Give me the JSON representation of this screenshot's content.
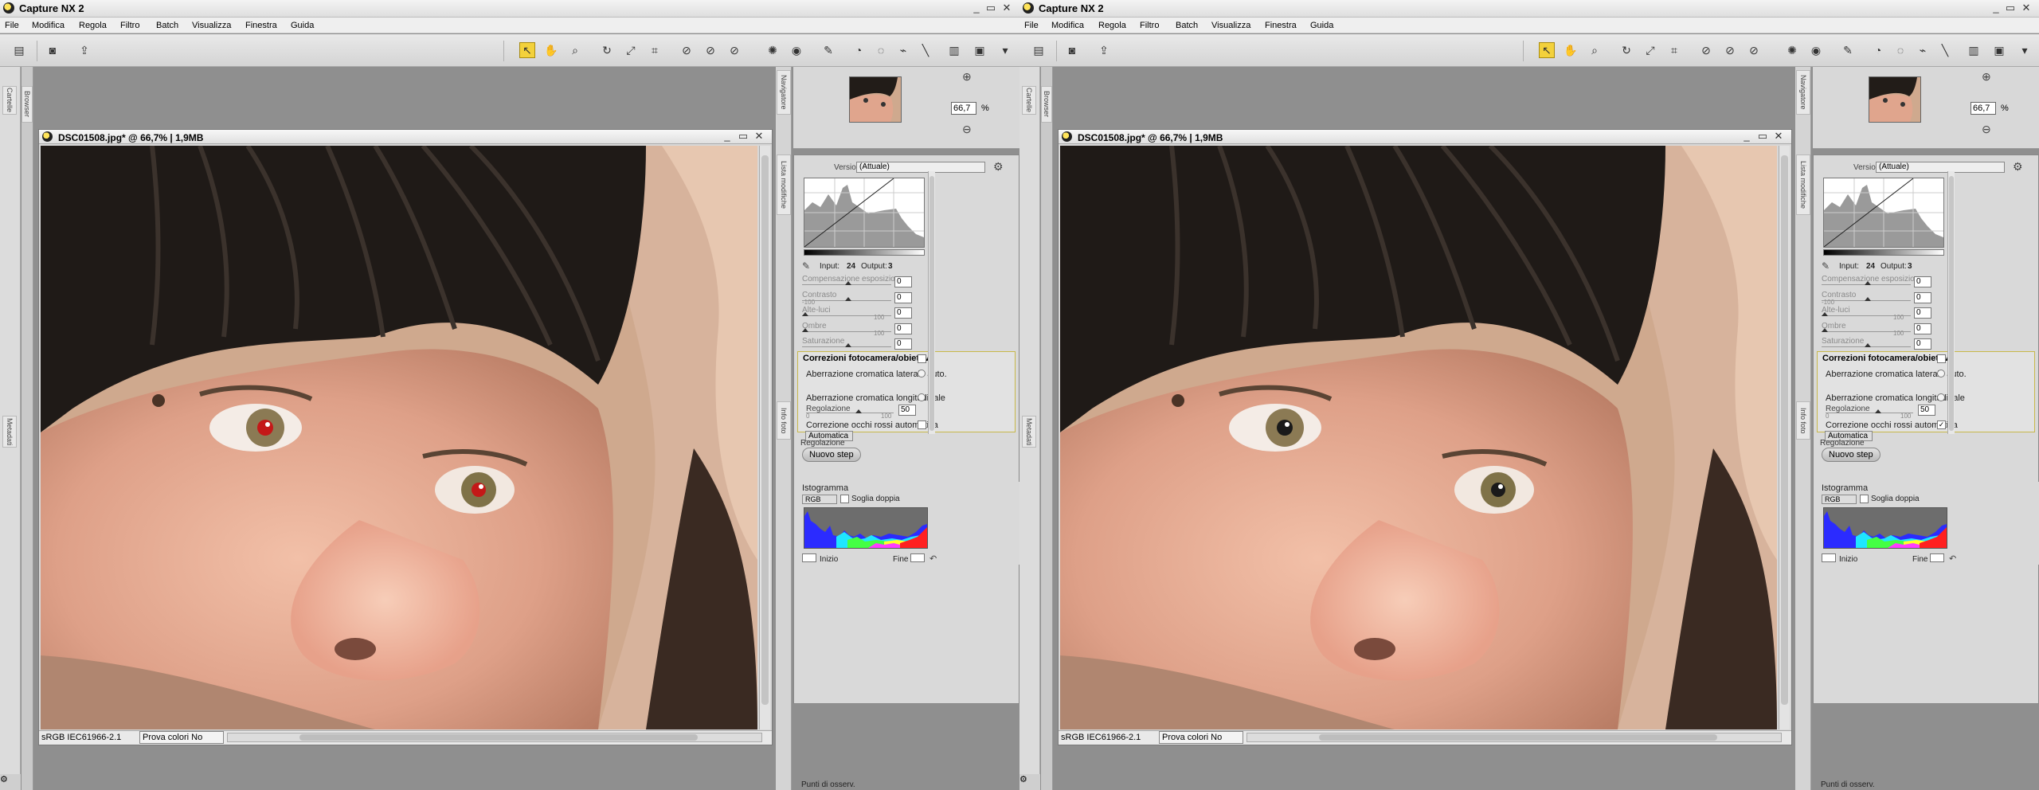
{
  "screens": [
    {
      "label": "before",
      "red_eye_checked": false,
      "app_title": "Capture NX 2",
      "window_controls": [
        "_",
        "▭",
        "✕"
      ],
      "menu": [
        "File",
        "Modifica",
        "Regola",
        "Filtro",
        "Batch",
        "Visualizza",
        "Finestra",
        "Guida"
      ],
      "document": {
        "title": "DSC01508.jpg* @ 66,7% | 1,9MB",
        "profile": "sRGB IEC61966-2.1",
        "proof": "Prova colori No"
      },
      "left_tabs": [
        "Browser",
        "Cartelle",
        "Metadati"
      ],
      "right_tabs": [
        "Navigatore",
        "Lista modifiche",
        "Info foto"
      ],
      "navigator": {
        "zoom_value": "66,7",
        "zoom_unit": "%"
      },
      "adjust": {
        "version_label": "Versione",
        "version_value": "(Attuale)",
        "input_label": "Input:",
        "input_value": "24",
        "output_label": "Output:",
        "output_value": "3",
        "sliders": [
          {
            "label": "Compensazione esposizione",
            "min": "",
            "max": "",
            "value": "0"
          },
          {
            "label": "Contrasto",
            "min": "-100",
            "max": "",
            "value": "0"
          },
          {
            "label": "Alte-luci",
            "min": "",
            "max": "100",
            "value": "0"
          },
          {
            "label": "Ombre",
            "min": "",
            "max": "100",
            "value": "0"
          },
          {
            "label": "Saturazione",
            "min": "",
            "max": "",
            "value": "0"
          }
        ],
        "camera_section": "Correzioni fotocamera/obiettivo",
        "aberr_lateral": "Aberrazione cromatica laterale auto.",
        "aberr_long": "Aberrazione cromatica longitudinale",
        "regolazione_label": "Regolazione",
        "reg_min": "0",
        "reg_max": "100",
        "reg_value": "50",
        "red_eye": "Correzione occhi rossi automatica",
        "auto_select": "Automatica",
        "regolazione_collapsed": "Regolazione",
        "new_step": "Nuovo step"
      },
      "histogram": {
        "title": "Istogramma",
        "channel": "RGB",
        "double": "Soglia doppia",
        "start": "Inizio",
        "end": "Fine"
      },
      "footer": "Punti di osserv."
    },
    {
      "label": "after",
      "red_eye_checked": true,
      "app_title": "Capture NX 2",
      "window_controls": [
        "_",
        "▭",
        "✕"
      ],
      "menu": [
        "File",
        "Modifica",
        "Regola",
        "Filtro",
        "Batch",
        "Visualizza",
        "Finestra",
        "Guida"
      ],
      "document": {
        "title": "DSC01508.jpg* @ 66,7% | 1,9MB",
        "profile": "sRGB IEC61966-2.1",
        "proof": "Prova colori No"
      },
      "left_tabs": [
        "Browser",
        "Cartelle",
        "Metadati"
      ],
      "right_tabs": [
        "Navigatore",
        "Lista modifiche",
        "Info foto"
      ],
      "navigator": {
        "zoom_value": "66,7",
        "zoom_unit": "%"
      },
      "adjust": {
        "version_label": "Versione",
        "version_value": "(Attuale)",
        "input_label": "Input:",
        "input_value": "24",
        "output_label": "Output:",
        "output_value": "3",
        "sliders": [
          {
            "label": "Compensazione esposizione",
            "min": "",
            "max": "",
            "value": "0"
          },
          {
            "label": "Contrasto",
            "min": "-100",
            "max": "",
            "value": "0"
          },
          {
            "label": "Alte-luci",
            "min": "",
            "max": "100",
            "value": "0"
          },
          {
            "label": "Ombre",
            "min": "",
            "max": "100",
            "value": "0"
          },
          {
            "label": "Saturazione",
            "min": "",
            "max": "",
            "value": "0"
          }
        ],
        "camera_section": "Correzioni fotocamera/obiettivo",
        "aberr_lateral": "Aberrazione cromatica laterale auto.",
        "aberr_long": "Aberrazione cromatica longitudinale",
        "regolazione_label": "Regolazione",
        "reg_min": "0",
        "reg_max": "100",
        "reg_value": "50",
        "red_eye": "Correzione occhi rossi automatica",
        "auto_select": "Automatica",
        "regolazione_collapsed": "Regolazione",
        "new_step": "Nuovo step"
      },
      "histogram": {
        "title": "Istogramma",
        "channel": "RGB",
        "double": "Soglia doppia",
        "start": "Inizio",
        "end": "Fine"
      },
      "footer": "Punti di osserv."
    }
  ],
  "colors": {
    "active_tool": "#f3d13b",
    "panel": "#d9d9d9",
    "section_border": "#c8b84a"
  }
}
